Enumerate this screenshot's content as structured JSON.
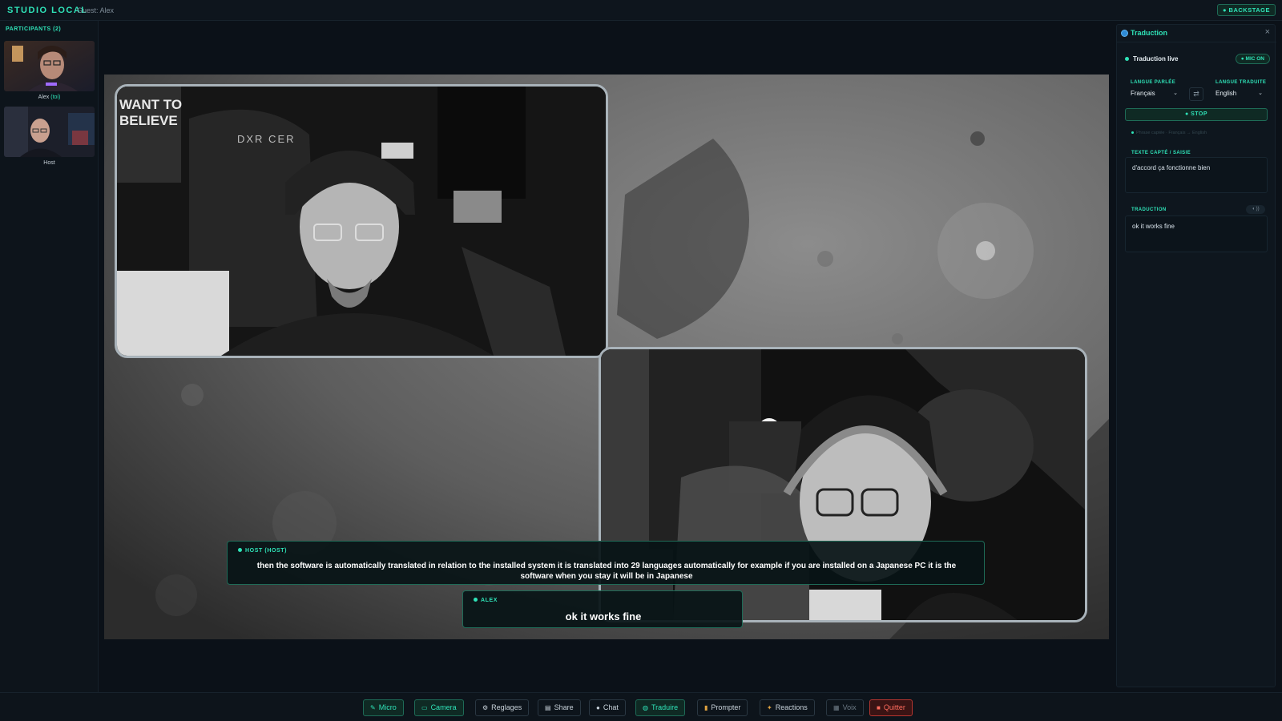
{
  "app": {
    "brand": "STUDIO LOCAL",
    "guest_label": "Guest: Alex",
    "backstage_label": "● BACKSTAGE"
  },
  "participants": {
    "title": "PARTICIPANTS (2)",
    "items": [
      {
        "name": "Alex",
        "suffix": "(toi)"
      },
      {
        "name": "Host",
        "suffix": ""
      }
    ]
  },
  "stage": {
    "host_caption": {
      "speaker": "HOST (HOST)",
      "text": "then the software is automatically translated in relation to the installed system it is translated into 29 languages automatically for example if you are installed on a Japanese PC it is the software when you stay it will be in Japanese"
    },
    "guest_caption": {
      "speaker": "ALEX",
      "text": "ok it works fine"
    },
    "host_tile_text": [
      "WANT TO",
      "BELIEVE",
      "DXR CER"
    ]
  },
  "translation_panel": {
    "title": "Traduction",
    "close": "×",
    "live_label": "Traduction live",
    "mic_status": "● MIC ON",
    "spoken_lang_label": "LANGUE PARLÉE",
    "translated_lang_label": "LANGUE TRADUITE",
    "spoken_lang": "Français",
    "translated_lang": "English",
    "swap_icon": "⇄",
    "stop_label": "● STOP",
    "hint": "Phrase captée · Français → English",
    "captured_label": "TEXTE CAPTÉ / SAISIE",
    "captured_text": "d'accord ça fonctionne bien",
    "translation_label": "TRADUCTION",
    "translation_text": "ok it works fine",
    "volume_icon": "◖ ))"
  },
  "toolbar": {
    "buttons": [
      {
        "label": "Micro",
        "icon": "mic-icon"
      },
      {
        "label": "Camera",
        "icon": "camera-icon"
      },
      {
        "label": "Reglages",
        "icon": "gear-icon"
      },
      {
        "label": "Share",
        "icon": "screen-icon"
      },
      {
        "label": "Chat",
        "icon": "chat-icon"
      },
      {
        "label": "Traduire",
        "icon": "globe-icon"
      },
      {
        "label": "Prompter",
        "icon": "document-icon"
      },
      {
        "label": "Reactions",
        "icon": "sparkle-icon"
      },
      {
        "label": "Voix",
        "icon": "voice-icon"
      },
      {
        "label": "Quitter",
        "icon": "exit-icon"
      }
    ]
  },
  "colors": {
    "accent": "#2fe3b8",
    "danger": "#ff6b5d",
    "background": "#0b1118"
  }
}
